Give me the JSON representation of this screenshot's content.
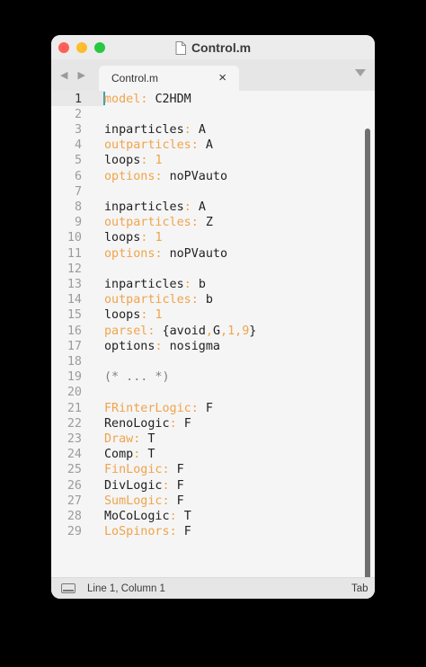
{
  "window": {
    "title": "Control.m"
  },
  "tabbar": {
    "nav_arrows": "◀ ▶",
    "tab_label": "Control.m",
    "tab_close": "×"
  },
  "editor": {
    "current_line": 1,
    "lines": [
      {
        "n": "1",
        "key": "model",
        "key_color": "orange",
        "value": "C2HDM"
      },
      {
        "n": "2"
      },
      {
        "n": "3",
        "key": "inparticles",
        "key_color": "plain",
        "value": "A"
      },
      {
        "n": "4",
        "key": "outparticles",
        "key_color": "orange",
        "value": "A"
      },
      {
        "n": "5",
        "key": "loops",
        "key_color": "plain",
        "value": "1",
        "value_color": "orange"
      },
      {
        "n": "6",
        "key": "options",
        "key_color": "orange",
        "value": "noPVauto"
      },
      {
        "n": "7"
      },
      {
        "n": "8",
        "key": "inparticles",
        "key_color": "plain",
        "value": "A"
      },
      {
        "n": "9",
        "key": "outparticles",
        "key_color": "orange",
        "value": "Z"
      },
      {
        "n": "10",
        "key": "loops",
        "key_color": "plain",
        "value": "1",
        "value_color": "orange"
      },
      {
        "n": "11",
        "key": "options",
        "key_color": "orange",
        "value": "noPVauto"
      },
      {
        "n": "12"
      },
      {
        "n": "13",
        "key": "inparticles",
        "key_color": "plain",
        "value": "b"
      },
      {
        "n": "14",
        "key": "outparticles",
        "key_color": "orange",
        "value": "b"
      },
      {
        "n": "15",
        "key": "loops",
        "key_color": "plain",
        "value": "1",
        "value_color": "orange"
      },
      {
        "n": "16",
        "key": "parsel",
        "key_color": "orange",
        "value": "{avoid,G,1,9}",
        "parsel": true
      },
      {
        "n": "17",
        "key": "options",
        "key_color": "plain",
        "value": "nosigma"
      },
      {
        "n": "18"
      },
      {
        "n": "19",
        "comment": "(* ... *)"
      },
      {
        "n": "20"
      },
      {
        "n": "21",
        "key": "FRinterLogic",
        "key_color": "orange",
        "value": "F"
      },
      {
        "n": "22",
        "key": "RenoLogic",
        "key_color": "plain",
        "value": "F"
      },
      {
        "n": "23",
        "key": "Draw",
        "key_color": "orange",
        "value": "T"
      },
      {
        "n": "24",
        "key": "Comp",
        "key_color": "plain",
        "value": "T"
      },
      {
        "n": "25",
        "key": "FinLogic",
        "key_color": "orange",
        "value": "F"
      },
      {
        "n": "26",
        "key": "DivLogic",
        "key_color": "plain",
        "value": "F"
      },
      {
        "n": "27",
        "key": "SumLogic",
        "key_color": "orange",
        "value": "F"
      },
      {
        "n": "28",
        "key": "MoCoLogic",
        "key_color": "plain",
        "value": "T"
      },
      {
        "n": "29",
        "key": "LoSpinors",
        "key_color": "orange",
        "value": "F"
      }
    ]
  },
  "statusbar": {
    "position": "Line 1, Column 1",
    "right_label": "Tab"
  },
  "colors": {
    "orange": "#f0a44b",
    "caret": "#3aa0b5",
    "close": "#ff5f57",
    "minimize": "#febc2e",
    "maximize": "#28c840"
  }
}
